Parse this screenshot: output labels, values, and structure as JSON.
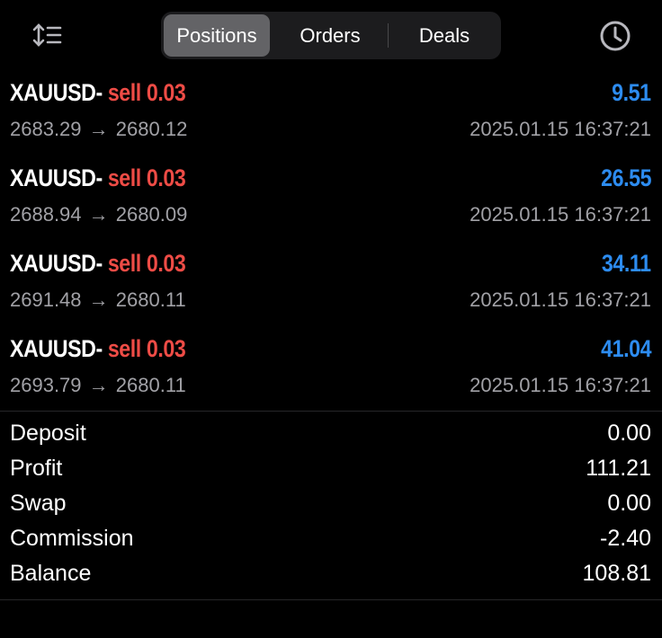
{
  "header": {
    "sort_icon": "sort-icon",
    "tabs": [
      {
        "label": "Positions",
        "active": true
      },
      {
        "label": "Orders",
        "active": false
      },
      {
        "label": "Deals",
        "active": false
      }
    ],
    "history_icon": "clock-icon"
  },
  "colors": {
    "background": "#000000",
    "sell": "#ee4c46",
    "profit_positive": "#2d8cf0",
    "secondary_text": "#a1a1a6",
    "segment_active": "#636366"
  },
  "deals": [
    {
      "symbol": "XAUUSD",
      "dash": "-",
      "type_volume": "sell 0.03",
      "profit": "9.51",
      "open_price": "2683.29",
      "arrow": "→",
      "close_price": "2680.12",
      "time": "2025.01.15 16:37:21"
    },
    {
      "symbol": "XAUUSD",
      "dash": "-",
      "type_volume": "sell 0.03",
      "profit": "26.55",
      "open_price": "2688.94",
      "arrow": "→",
      "close_price": "2680.09",
      "time": "2025.01.15 16:37:21"
    },
    {
      "symbol": "XAUUSD",
      "dash": "-",
      "type_volume": "sell 0.03",
      "profit": "34.11",
      "open_price": "2691.48",
      "arrow": "→",
      "close_price": "2680.11",
      "time": "2025.01.15 16:37:21"
    },
    {
      "symbol": "XAUUSD",
      "dash": "-",
      "type_volume": "sell 0.03",
      "profit": "41.04",
      "open_price": "2693.79",
      "arrow": "→",
      "close_price": "2680.11",
      "time": "2025.01.15 16:37:21"
    }
  ],
  "summary": [
    {
      "label": "Deposit",
      "value": "0.00"
    },
    {
      "label": "Profit",
      "value": "111.21"
    },
    {
      "label": "Swap",
      "value": "0.00"
    },
    {
      "label": "Commission",
      "value": "-2.40"
    },
    {
      "label": "Balance",
      "value": "108.81"
    }
  ]
}
